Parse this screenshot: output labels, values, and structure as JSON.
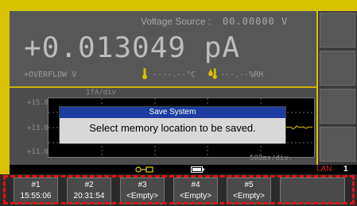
{
  "header": {
    "voltage_source_label": "Voltage Source :",
    "voltage_source_value": "00.00000  V"
  },
  "reading": {
    "value": "+0.013049 pA",
    "overflow_text": "+OVERFLOW  V",
    "temperature_text": "----.--°C",
    "humidity_text": "---.--%RH"
  },
  "graph": {
    "per_div_label": "1fA/div",
    "tick_top": "+15.0",
    "tick_mid": "+13.0",
    "tick_bottom": "+11.0fA",
    "time_div_label": "500ms/div."
  },
  "dialog": {
    "title": "Save System",
    "message": "Select memory location to be saved."
  },
  "status": {
    "lan_label": "LAN",
    "lan_count": "1"
  },
  "softkeys": [
    {
      "line1": "#1",
      "line2": "15:55:06"
    },
    {
      "line1": "#2",
      "line2": "20:31:54"
    },
    {
      "line1": "#3",
      "line2": "<Empty>"
    },
    {
      "line1": "#4",
      "line2": "<Empty>"
    },
    {
      "line1": "#5",
      "line2": "<Empty>"
    }
  ],
  "colors": {
    "frame": "#d8c200",
    "dialog_title_bg": "#1d3ea0",
    "highlight_dash": "#e81010",
    "trace": "#d8c200"
  },
  "icons": [
    "thermometer-icon",
    "humidity-icon",
    "usb-icon",
    "battery-icon"
  ]
}
